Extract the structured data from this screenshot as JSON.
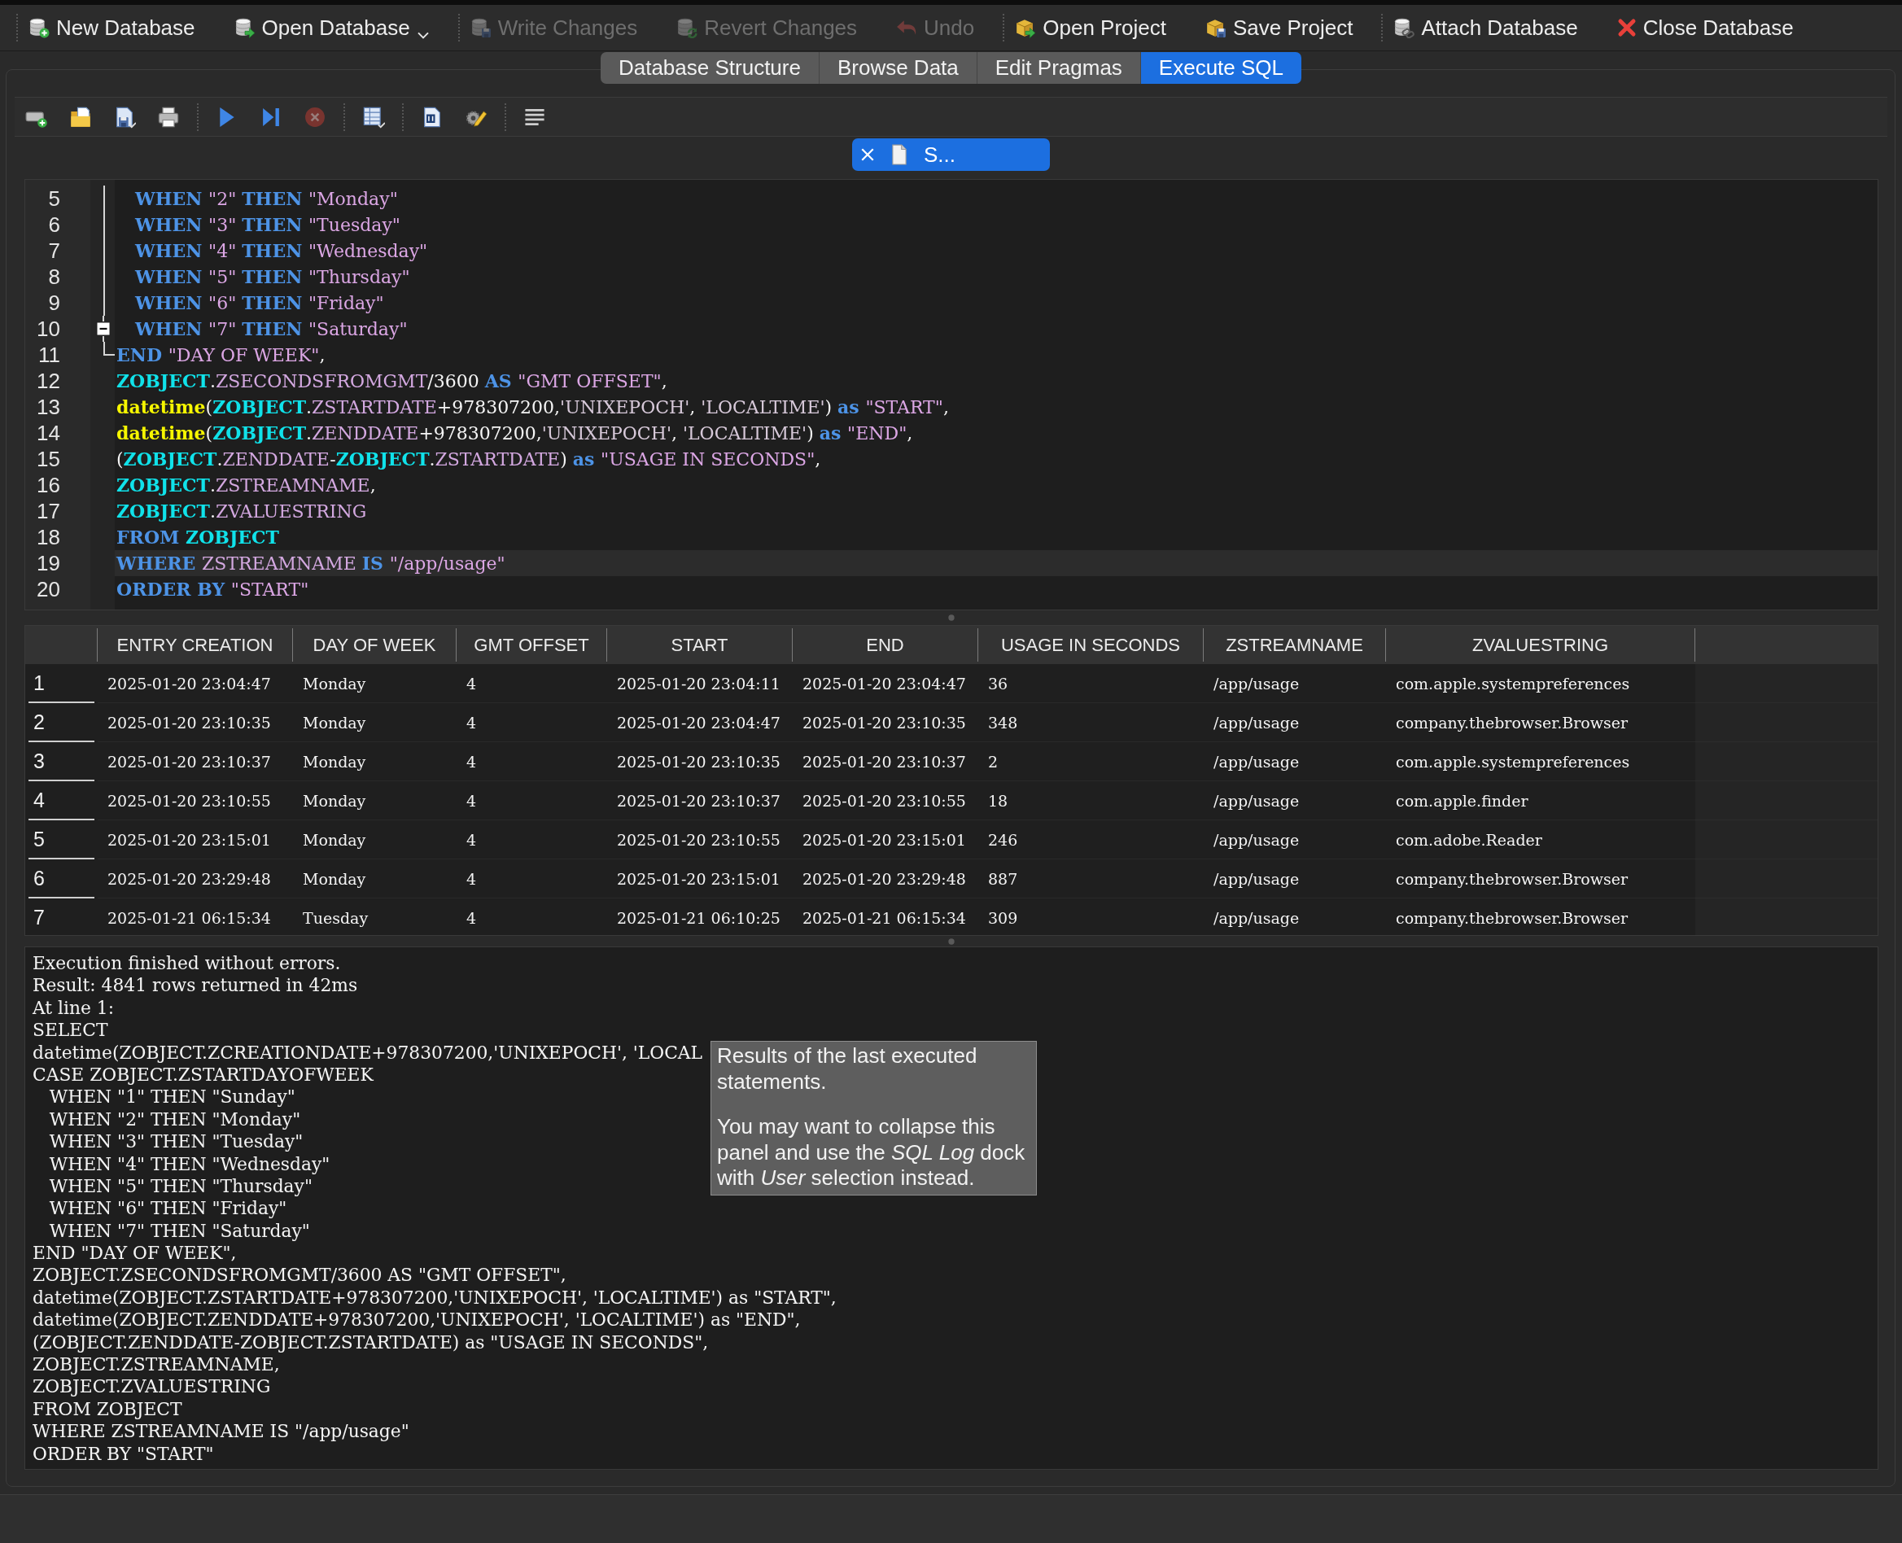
{
  "toolbar": {
    "items": [
      {
        "kind": "separator"
      },
      {
        "kind": "button",
        "label": "New Database",
        "disabled": false
      },
      {
        "kind": "button",
        "label": "Open Database",
        "disabled": false,
        "dropdown": true
      },
      {
        "kind": "separator"
      },
      {
        "kind": "button",
        "label": "Write Changes",
        "disabled": true
      },
      {
        "kind": "button",
        "label": "Revert Changes",
        "disabled": true
      },
      {
        "kind": "button",
        "label": "Undo",
        "disabled": true
      },
      {
        "kind": "separator"
      },
      {
        "kind": "button",
        "label": "Open Project",
        "disabled": false
      },
      {
        "kind": "button",
        "label": "Save Project",
        "disabled": false
      },
      {
        "kind": "separator"
      },
      {
        "kind": "button",
        "label": "Attach Database",
        "disabled": false
      },
      {
        "kind": "button",
        "label": "Close Database",
        "disabled": false
      }
    ]
  },
  "tabs": [
    {
      "label": "Database Structure",
      "selected": false
    },
    {
      "label": "Browse Data",
      "selected": false
    },
    {
      "label": "Edit Pragmas",
      "selected": false
    },
    {
      "label": "Execute SQL",
      "selected": true
    }
  ],
  "sql_toolbar": {
    "items": [
      {
        "kind": "button",
        "disabled": false
      },
      {
        "kind": "button",
        "disabled": false
      },
      {
        "kind": "button",
        "disabled": false
      },
      {
        "kind": "button",
        "disabled": false
      },
      {
        "kind": "separator"
      },
      {
        "kind": "button",
        "disabled": false
      },
      {
        "kind": "button",
        "disabled": false
      },
      {
        "kind": "button",
        "disabled": true
      },
      {
        "kind": "separator"
      },
      {
        "kind": "button",
        "disabled": false
      },
      {
        "kind": "separator"
      },
      {
        "kind": "button",
        "disabled": false
      },
      {
        "kind": "button",
        "disabled": false
      },
      {
        "kind": "separator"
      },
      {
        "kind": "button",
        "disabled": false
      }
    ]
  },
  "editor_tabs": [
    {
      "label": "S...",
      "selected": true
    }
  ],
  "editor": {
    "lines": [
      {
        "number": "5",
        "kind": "fold-body",
        "current": false,
        "tokens": [
          {
            "kind": "keyword",
            "text": "   WHEN "
          },
          {
            "kind": "string",
            "text": "\"2\" "
          },
          {
            "kind": "keyword",
            "text": "THEN "
          },
          {
            "kind": "string",
            "text": "\"Monday\""
          }
        ]
      },
      {
        "number": "6",
        "kind": "fold-body",
        "current": false,
        "tokens": [
          {
            "kind": "keyword",
            "text": "   WHEN "
          },
          {
            "kind": "string",
            "text": "\"3\" "
          },
          {
            "kind": "keyword",
            "text": "THEN "
          },
          {
            "kind": "string",
            "text": "\"Tuesday\""
          }
        ]
      },
      {
        "number": "7",
        "kind": "fold-body",
        "current": false,
        "tokens": [
          {
            "kind": "keyword",
            "text": "   WHEN "
          },
          {
            "kind": "string",
            "text": "\"4\" "
          },
          {
            "kind": "keyword",
            "text": "THEN "
          },
          {
            "kind": "string",
            "text": "\"Wednesday\""
          }
        ]
      },
      {
        "number": "8",
        "kind": "fold-body",
        "current": false,
        "tokens": [
          {
            "kind": "keyword",
            "text": "   WHEN "
          },
          {
            "kind": "string",
            "text": "\"5\" "
          },
          {
            "kind": "keyword",
            "text": "THEN "
          },
          {
            "kind": "string",
            "text": "\"Thursday\""
          }
        ]
      },
      {
        "number": "9",
        "kind": "fold-body",
        "current": false,
        "tokens": [
          {
            "kind": "keyword",
            "text": "   WHEN "
          },
          {
            "kind": "string",
            "text": "\"6\" "
          },
          {
            "kind": "keyword",
            "text": "THEN "
          },
          {
            "kind": "string",
            "text": "\"Friday\""
          }
        ]
      },
      {
        "number": "10",
        "kind": "fold-toggle",
        "current": false,
        "tokens": [
          {
            "kind": "keyword",
            "text": "   WHEN "
          },
          {
            "kind": "string",
            "text": "\"7\" "
          },
          {
            "kind": "keyword",
            "text": "THEN "
          },
          {
            "kind": "string",
            "text": "\"Saturday\""
          }
        ]
      },
      {
        "number": "11",
        "kind": "fold-end",
        "current": false,
        "tokens": [
          {
            "kind": "keyword",
            "text": "END "
          },
          {
            "kind": "string",
            "text": "\"DAY OF WEEK\""
          },
          {
            "kind": "plain",
            "text": ","
          }
        ]
      },
      {
        "number": "12",
        "kind": "code",
        "current": false,
        "tokens": [
          {
            "kind": "table",
            "text": "ZOBJECT"
          },
          {
            "kind": "plain",
            "text": "."
          },
          {
            "kind": "column",
            "text": "ZSECONDSFROMGMT"
          },
          {
            "kind": "plain",
            "text": "/3600 "
          },
          {
            "kind": "keyword",
            "text": "AS "
          },
          {
            "kind": "string",
            "text": "\"GMT OFFSET\""
          },
          {
            "kind": "plain",
            "text": ","
          }
        ]
      },
      {
        "number": "13",
        "kind": "code",
        "current": false,
        "tokens": [
          {
            "kind": "function",
            "text": "datetime"
          },
          {
            "kind": "plain",
            "text": "("
          },
          {
            "kind": "table",
            "text": "ZOBJECT"
          },
          {
            "kind": "plain",
            "text": "."
          },
          {
            "kind": "column",
            "text": "ZSTARTDATE"
          },
          {
            "kind": "plain",
            "text": "+978307200,"
          },
          {
            "kind": "literal",
            "text": "'UNIXEPOCH'"
          },
          {
            "kind": "plain",
            "text": ", "
          },
          {
            "kind": "literal",
            "text": "'LOCALTIME'"
          },
          {
            "kind": "plain",
            "text": ") "
          },
          {
            "kind": "keyword",
            "text": "as "
          },
          {
            "kind": "string",
            "text": "\"START\""
          },
          {
            "kind": "plain",
            "text": ","
          }
        ]
      },
      {
        "number": "14",
        "kind": "code",
        "current": false,
        "tokens": [
          {
            "kind": "function",
            "text": "datetime"
          },
          {
            "kind": "plain",
            "text": "("
          },
          {
            "kind": "table",
            "text": "ZOBJECT"
          },
          {
            "kind": "plain",
            "text": "."
          },
          {
            "kind": "column",
            "text": "ZENDDATE"
          },
          {
            "kind": "plain",
            "text": "+978307200,"
          },
          {
            "kind": "literal",
            "text": "'UNIXEPOCH'"
          },
          {
            "kind": "plain",
            "text": ", "
          },
          {
            "kind": "literal",
            "text": "'LOCALTIME'"
          },
          {
            "kind": "plain",
            "text": ") "
          },
          {
            "kind": "keyword",
            "text": "as "
          },
          {
            "kind": "string",
            "text": "\"END\""
          },
          {
            "kind": "plain",
            "text": ","
          }
        ]
      },
      {
        "number": "15",
        "kind": "code",
        "current": false,
        "tokens": [
          {
            "kind": "plain",
            "text": "("
          },
          {
            "kind": "table",
            "text": "ZOBJECT"
          },
          {
            "kind": "plain",
            "text": "."
          },
          {
            "kind": "column",
            "text": "ZENDDATE"
          },
          {
            "kind": "plain",
            "text": "-"
          },
          {
            "kind": "table",
            "text": "ZOBJECT"
          },
          {
            "kind": "plain",
            "text": "."
          },
          {
            "kind": "column",
            "text": "ZSTARTDATE"
          },
          {
            "kind": "plain",
            "text": ") "
          },
          {
            "kind": "keyword",
            "text": "as "
          },
          {
            "kind": "string",
            "text": "\"USAGE IN SECONDS\""
          },
          {
            "kind": "plain",
            "text": ","
          }
        ]
      },
      {
        "number": "16",
        "kind": "code",
        "current": false,
        "tokens": [
          {
            "kind": "table",
            "text": "ZOBJECT"
          },
          {
            "kind": "plain",
            "text": "."
          },
          {
            "kind": "column",
            "text": "ZSTREAMNAME"
          },
          {
            "kind": "plain",
            "text": ","
          }
        ]
      },
      {
        "number": "17",
        "kind": "code",
        "current": false,
        "tokens": [
          {
            "kind": "table",
            "text": "ZOBJECT"
          },
          {
            "kind": "plain",
            "text": "."
          },
          {
            "kind": "column",
            "text": "ZVALUESTRING"
          }
        ]
      },
      {
        "number": "18",
        "kind": "code",
        "current": false,
        "tokens": [
          {
            "kind": "keyword",
            "text": "FROM "
          },
          {
            "kind": "table",
            "text": "ZOBJECT"
          }
        ]
      },
      {
        "number": "19",
        "kind": "code",
        "current": true,
        "tokens": [
          {
            "kind": "keyword",
            "text": "WHERE "
          },
          {
            "kind": "column",
            "text": "ZSTREAMNAME "
          },
          {
            "kind": "keyword",
            "text": "IS "
          },
          {
            "kind": "string",
            "text": "\"/app/usage\""
          }
        ]
      },
      {
        "number": "20",
        "kind": "code",
        "current": false,
        "tokens": [
          {
            "kind": "keyword",
            "text": "ORDER BY "
          },
          {
            "kind": "string",
            "text": "\"START\""
          }
        ]
      }
    ]
  },
  "results": {
    "columns": [
      "ENTRY CREATION",
      "DAY OF WEEK",
      "GMT OFFSET",
      "START",
      "END",
      "USAGE IN SECONDS",
      "ZSTREAMNAME",
      "ZVALUESTRING"
    ],
    "rows": [
      {
        "number": "1",
        "cells": [
          "2025-01-20 23:04:47",
          "Monday",
          "4",
          "2025-01-20 23:04:11",
          "2025-01-20 23:04:47",
          "36",
          "/app/usage",
          "com.apple.systempreferences"
        ]
      },
      {
        "number": "2",
        "cells": [
          "2025-01-20 23:10:35",
          "Monday",
          "4",
          "2025-01-20 23:04:47",
          "2025-01-20 23:10:35",
          "348",
          "/app/usage",
          "company.thebrowser.Browser"
        ]
      },
      {
        "number": "3",
        "cells": [
          "2025-01-20 23:10:37",
          "Monday",
          "4",
          "2025-01-20 23:10:35",
          "2025-01-20 23:10:37",
          "2",
          "/app/usage",
          "com.apple.systempreferences"
        ]
      },
      {
        "number": "4",
        "cells": [
          "2025-01-20 23:10:55",
          "Monday",
          "4",
          "2025-01-20 23:10:37",
          "2025-01-20 23:10:55",
          "18",
          "/app/usage",
          "com.apple.finder"
        ]
      },
      {
        "number": "5",
        "cells": [
          "2025-01-20 23:15:01",
          "Monday",
          "4",
          "2025-01-20 23:10:55",
          "2025-01-20 23:15:01",
          "246",
          "/app/usage",
          "com.adobe.Reader"
        ]
      },
      {
        "number": "6",
        "cells": [
          "2025-01-20 23:29:48",
          "Monday",
          "4",
          "2025-01-20 23:15:01",
          "2025-01-20 23:29:48",
          "887",
          "/app/usage",
          "company.thebrowser.Browser"
        ]
      },
      {
        "number": "7",
        "cells": [
          "2025-01-21 06:15:34",
          "Tuesday",
          "4",
          "2025-01-21 06:10:25",
          "2025-01-21 06:15:34",
          "309",
          "/app/usage",
          "company.thebrowser.Browser"
        ]
      }
    ]
  },
  "message_log": {
    "lines": [
      "Execution finished without errors.",
      "Result: 4841 rows returned in 42ms",
      "At line 1:",
      "SELECT",
      "datetime(ZOBJECT.ZCREATIONDATE+978307200,'UNIXEPOCH', 'LOCAL",
      "CASE ZOBJECT.ZSTARTDAYOFWEEK",
      "   WHEN \"1\" THEN \"Sunday\"",
      "   WHEN \"2\" THEN \"Monday\"",
      "   WHEN \"3\" THEN \"Tuesday\"",
      "   WHEN \"4\" THEN \"Wednesday\"",
      "   WHEN \"5\" THEN \"Thursday\"",
      "   WHEN \"6\" THEN \"Friday\"",
      "   WHEN \"7\" THEN \"Saturday\"",
      "END \"DAY OF WEEK\",",
      "ZOBJECT.ZSECONDSFROMGMT/3600 AS \"GMT OFFSET\",",
      "datetime(ZOBJECT.ZSTARTDATE+978307200,'UNIXEPOCH', 'LOCALTIME') as \"START\",",
      "datetime(ZOBJECT.ZENDDATE+978307200,'UNIXEPOCH', 'LOCALTIME') as \"END\",",
      "(ZOBJECT.ZENDDATE-ZOBJECT.ZSTARTDATE) as \"USAGE IN SECONDS\",",
      "ZOBJECT.ZSTREAMNAME,",
      "ZOBJECT.ZVALUESTRING",
      "FROM ZOBJECT",
      "WHERE ZSTREAMNAME IS \"/app/usage\"",
      "ORDER BY \"START\""
    ]
  },
  "tooltip": {
    "paragraphs": [
      "Results of the last executed statements.",
      "You may want to collapse this panel and use the *SQL Log* dock with *User* selection instead."
    ]
  }
}
